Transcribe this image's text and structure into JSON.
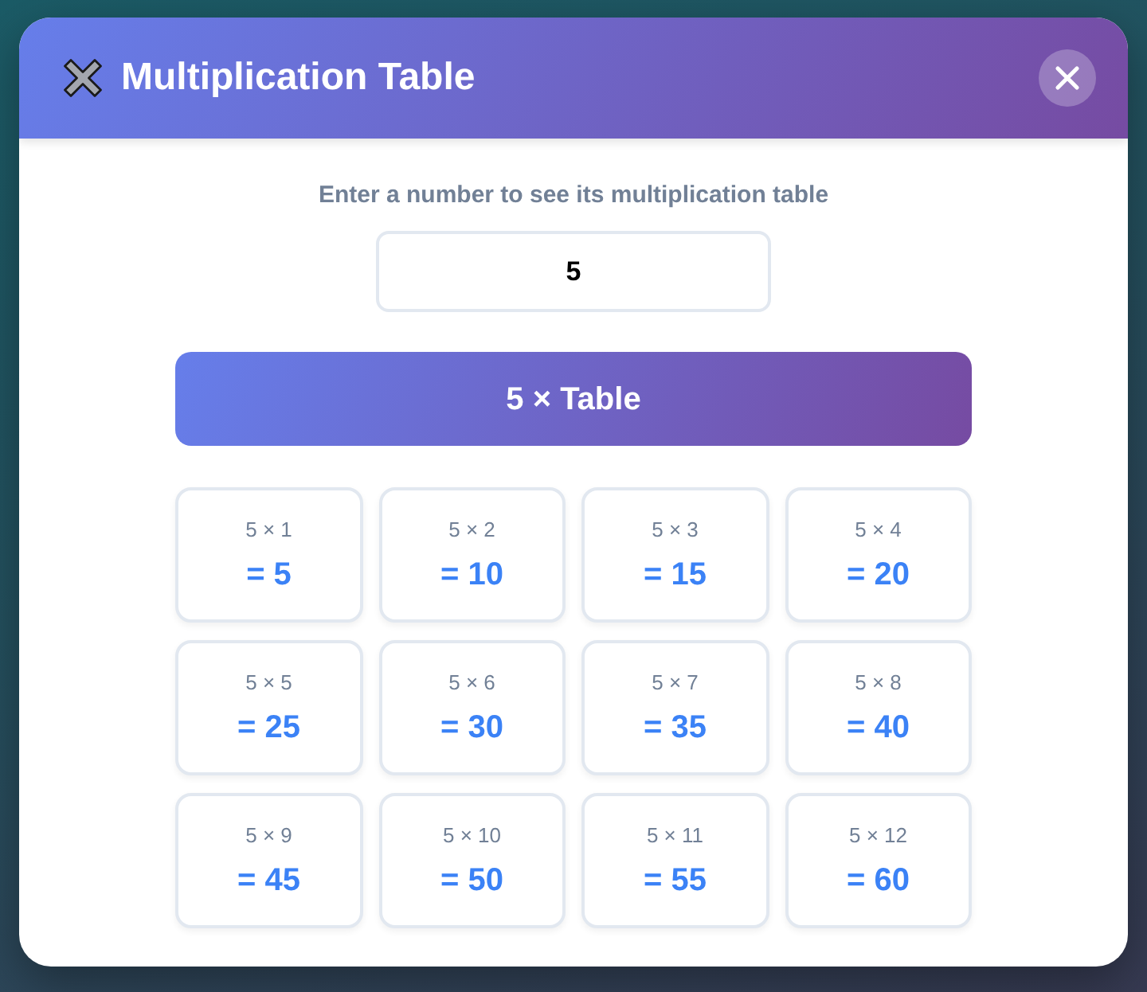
{
  "dialog": {
    "title": "Multiplication Table"
  },
  "prompt": "Enter a number to see its multiplication table",
  "input": {
    "value": "5"
  },
  "banner": {
    "title": "5 × Table"
  },
  "entries": [
    {
      "expression": "5 × 1",
      "result": "= 5"
    },
    {
      "expression": "5 × 2",
      "result": "= 10"
    },
    {
      "expression": "5 × 3",
      "result": "= 15"
    },
    {
      "expression": "5 × 4",
      "result": "= 20"
    },
    {
      "expression": "5 × 5",
      "result": "= 25"
    },
    {
      "expression": "5 × 6",
      "result": "= 30"
    },
    {
      "expression": "5 × 7",
      "result": "= 35"
    },
    {
      "expression": "5 × 8",
      "result": "= 40"
    },
    {
      "expression": "5 × 9",
      "result": "= 45"
    },
    {
      "expression": "5 × 10",
      "result": "= 50"
    },
    {
      "expression": "5 × 11",
      "result": "= 55"
    },
    {
      "expression": "5 × 12",
      "result": "= 60"
    }
  ]
}
